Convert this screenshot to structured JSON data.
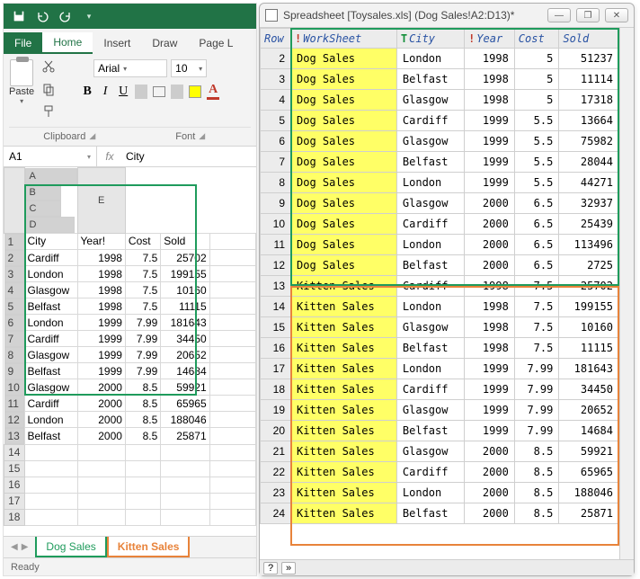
{
  "excel": {
    "tabs": {
      "file": "File",
      "home": "Home",
      "insert": "Insert",
      "draw": "Draw",
      "page": "Page L"
    },
    "paste_label": "Paste",
    "font_name": "Arial",
    "font_size": "10",
    "group_clipboard": "Clipboard",
    "group_font": "Font",
    "namebox": "A1",
    "formula": "City",
    "columns": [
      "A",
      "B",
      "C",
      "D",
      "E"
    ],
    "rows": [
      {
        "n": "1",
        "c": [
          "City",
          "Year!",
          "Cost",
          "Sold",
          ""
        ]
      },
      {
        "n": "2",
        "c": [
          "Cardiff",
          "1998",
          "7.5",
          "25702",
          ""
        ]
      },
      {
        "n": "3",
        "c": [
          "London",
          "1998",
          "7.5",
          "199155",
          ""
        ]
      },
      {
        "n": "4",
        "c": [
          "Glasgow",
          "1998",
          "7.5",
          "10160",
          ""
        ]
      },
      {
        "n": "5",
        "c": [
          "Belfast",
          "1998",
          "7.5",
          "11115",
          ""
        ]
      },
      {
        "n": "6",
        "c": [
          "London",
          "1999",
          "7.99",
          "181643",
          ""
        ]
      },
      {
        "n": "7",
        "c": [
          "Cardiff",
          "1999",
          "7.99",
          "34450",
          ""
        ]
      },
      {
        "n": "8",
        "c": [
          "Glasgow",
          "1999",
          "7.99",
          "20652",
          ""
        ]
      },
      {
        "n": "9",
        "c": [
          "Belfast",
          "1999",
          "7.99",
          "14684",
          ""
        ]
      },
      {
        "n": "10",
        "c": [
          "Glasgow",
          "2000",
          "8.5",
          "59921",
          ""
        ]
      },
      {
        "n": "11",
        "c": [
          "Cardiff",
          "2000",
          "8.5",
          "65965",
          ""
        ]
      },
      {
        "n": "12",
        "c": [
          "London",
          "2000",
          "8.5",
          "188046",
          ""
        ]
      },
      {
        "n": "13",
        "c": [
          "Belfast",
          "2000",
          "8.5",
          "25871",
          ""
        ]
      },
      {
        "n": "14",
        "c": [
          "",
          "",
          "",
          "",
          ""
        ]
      },
      {
        "n": "15",
        "c": [
          "",
          "",
          "",
          "",
          ""
        ]
      },
      {
        "n": "16",
        "c": [
          "",
          "",
          "",
          "",
          ""
        ]
      },
      {
        "n": "17",
        "c": [
          "",
          "",
          "",
          "",
          ""
        ]
      },
      {
        "n": "18",
        "c": [
          "",
          "",
          "",
          "",
          ""
        ]
      }
    ],
    "sheet1": "Dog Sales",
    "sheet2": "Kitten Sales",
    "status": "Ready"
  },
  "dwin": {
    "title": "Spreadsheet [Toysales.xls] (Dog Sales!A2:D13)*",
    "headers": {
      "row": "Row",
      "ws": "WorkSheet",
      "city": "City",
      "year": "Year",
      "cost": "Cost",
      "sold": "Sold"
    },
    "rows": [
      {
        "n": "2",
        "ws": "Dog Sales",
        "city": "London",
        "year": "1998",
        "cost": "5",
        "sold": "51237"
      },
      {
        "n": "3",
        "ws": "Dog Sales",
        "city": "Belfast",
        "year": "1998",
        "cost": "5",
        "sold": "11114"
      },
      {
        "n": "4",
        "ws": "Dog Sales",
        "city": "Glasgow",
        "year": "1998",
        "cost": "5",
        "sold": "17318"
      },
      {
        "n": "5",
        "ws": "Dog Sales",
        "city": "Cardiff",
        "year": "1999",
        "cost": "5.5",
        "sold": "13664"
      },
      {
        "n": "6",
        "ws": "Dog Sales",
        "city": "Glasgow",
        "year": "1999",
        "cost": "5.5",
        "sold": "75982"
      },
      {
        "n": "7",
        "ws": "Dog Sales",
        "city": "Belfast",
        "year": "1999",
        "cost": "5.5",
        "sold": "28044"
      },
      {
        "n": "8",
        "ws": "Dog Sales",
        "city": "London",
        "year": "1999",
        "cost": "5.5",
        "sold": "44271"
      },
      {
        "n": "9",
        "ws": "Dog Sales",
        "city": "Glasgow",
        "year": "2000",
        "cost": "6.5",
        "sold": "32937"
      },
      {
        "n": "10",
        "ws": "Dog Sales",
        "city": "Cardiff",
        "year": "2000",
        "cost": "6.5",
        "sold": "25439"
      },
      {
        "n": "11",
        "ws": "Dog Sales",
        "city": "London",
        "year": "2000",
        "cost": "6.5",
        "sold": "113496"
      },
      {
        "n": "12",
        "ws": "Dog Sales",
        "city": "Belfast",
        "year": "2000",
        "cost": "6.5",
        "sold": "2725"
      },
      {
        "n": "13",
        "ws": "Kitten Sales",
        "city": "Cardiff",
        "year": "1998",
        "cost": "7.5",
        "sold": "25702"
      },
      {
        "n": "14",
        "ws": "Kitten Sales",
        "city": "London",
        "year": "1998",
        "cost": "7.5",
        "sold": "199155"
      },
      {
        "n": "15",
        "ws": "Kitten Sales",
        "city": "Glasgow",
        "year": "1998",
        "cost": "7.5",
        "sold": "10160"
      },
      {
        "n": "16",
        "ws": "Kitten Sales",
        "city": "Belfast",
        "year": "1998",
        "cost": "7.5",
        "sold": "11115"
      },
      {
        "n": "17",
        "ws": "Kitten Sales",
        "city": "London",
        "year": "1999",
        "cost": "7.99",
        "sold": "181643"
      },
      {
        "n": "18",
        "ws": "Kitten Sales",
        "city": "Cardiff",
        "year": "1999",
        "cost": "7.99",
        "sold": "34450"
      },
      {
        "n": "19",
        "ws": "Kitten Sales",
        "city": "Glasgow",
        "year": "1999",
        "cost": "7.99",
        "sold": "20652"
      },
      {
        "n": "20",
        "ws": "Kitten Sales",
        "city": "Belfast",
        "year": "1999",
        "cost": "7.99",
        "sold": "14684"
      },
      {
        "n": "21",
        "ws": "Kitten Sales",
        "city": "Glasgow",
        "year": "2000",
        "cost": "8.5",
        "sold": "59921"
      },
      {
        "n": "22",
        "ws": "Kitten Sales",
        "city": "Cardiff",
        "year": "2000",
        "cost": "8.5",
        "sold": "65965"
      },
      {
        "n": "23",
        "ws": "Kitten Sales",
        "city": "London",
        "year": "2000",
        "cost": "8.5",
        "sold": "188046"
      },
      {
        "n": "24",
        "ws": "Kitten Sales",
        "city": "Belfast",
        "year": "2000",
        "cost": "8.5",
        "sold": "25871"
      }
    ],
    "qmark": "?",
    "chevrons": "»"
  }
}
